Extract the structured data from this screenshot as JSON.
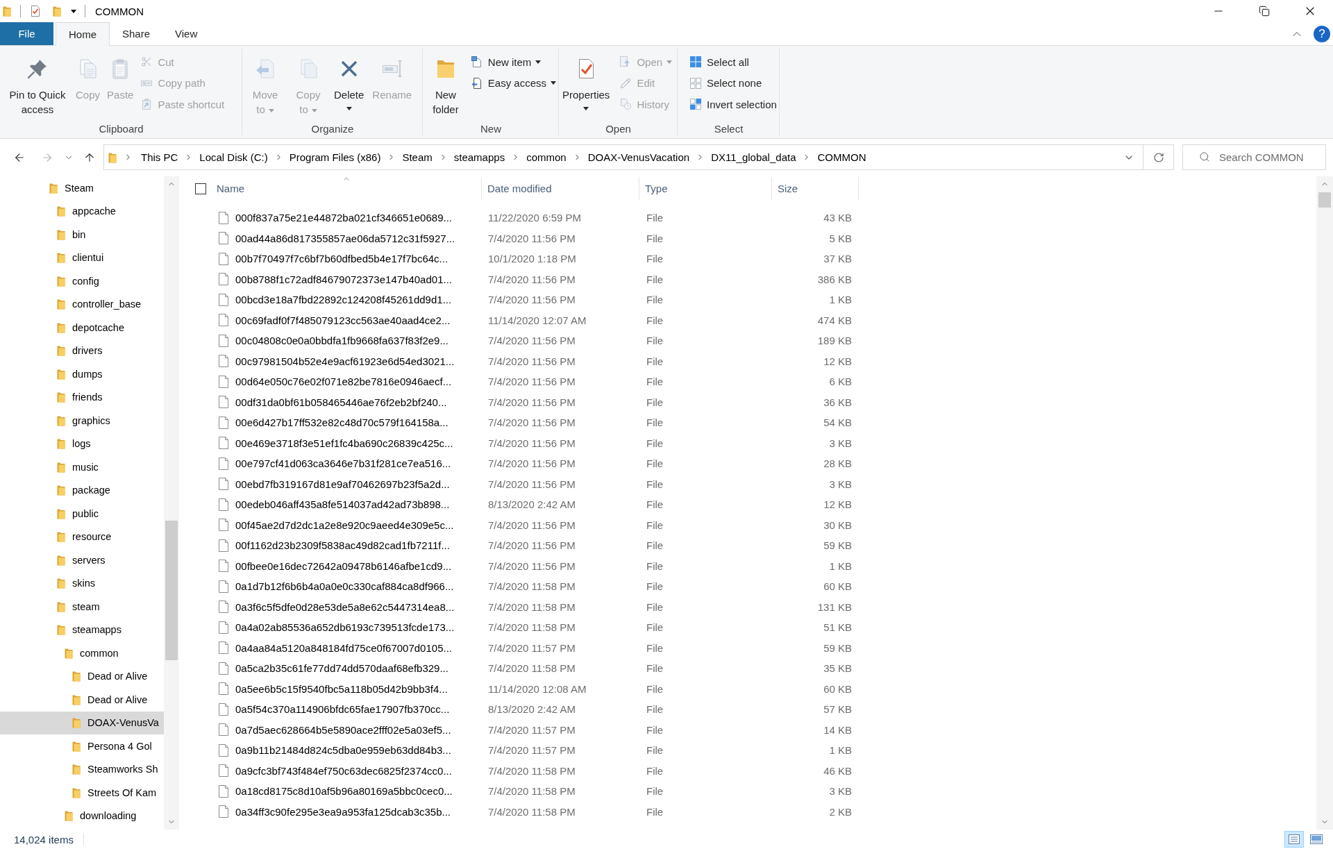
{
  "window": {
    "title": "COMMON"
  },
  "ribbon_tabs": [
    {
      "label": "File",
      "kind": "file",
      "selected": false
    },
    {
      "label": "Home",
      "kind": "tab",
      "selected": true
    },
    {
      "label": "Share",
      "kind": "tab",
      "selected": false
    },
    {
      "label": "View",
      "kind": "tab",
      "selected": false
    }
  ],
  "help_button": "?",
  "ribbon_groups": [
    {
      "label": "Clipboard",
      "commands": [
        {
          "label": "Pin to Quick access",
          "kind": "large",
          "disabled": false,
          "dropdown": false
        },
        {
          "label": "Copy",
          "kind": "large",
          "disabled": true,
          "dropdown": false
        },
        {
          "label": "Paste",
          "kind": "large",
          "disabled": true,
          "dropdown": false
        },
        {
          "label": "Cut",
          "kind": "small",
          "disabled": true,
          "dropdown": false
        },
        {
          "label": "Copy path",
          "kind": "small",
          "disabled": true,
          "dropdown": false
        },
        {
          "label": "Paste shortcut",
          "kind": "small",
          "disabled": true,
          "dropdown": false
        }
      ]
    },
    {
      "label": "Organize",
      "commands": [
        {
          "label": "Move to",
          "kind": "large",
          "disabled": true,
          "dropdown": true
        },
        {
          "label": "Copy to",
          "kind": "large",
          "disabled": true,
          "dropdown": true
        },
        {
          "label": "Delete",
          "kind": "large",
          "disabled": false,
          "dropdown": true
        },
        {
          "label": "Rename",
          "kind": "large",
          "disabled": true,
          "dropdown": false
        }
      ]
    },
    {
      "label": "New",
      "commands": [
        {
          "label": "New folder",
          "kind": "large",
          "disabled": false,
          "dropdown": false
        },
        {
          "label": "New item",
          "kind": "small",
          "disabled": false,
          "dropdown": true
        },
        {
          "label": "Easy access",
          "kind": "small",
          "disabled": false,
          "dropdown": true
        }
      ]
    },
    {
      "label": "Open",
      "commands": [
        {
          "label": "Properties",
          "kind": "large",
          "disabled": false,
          "dropdown": true
        },
        {
          "label": "Open",
          "kind": "small",
          "disabled": true,
          "dropdown": true
        },
        {
          "label": "Edit",
          "kind": "small",
          "disabled": true,
          "dropdown": false
        },
        {
          "label": "History",
          "kind": "small",
          "disabled": true,
          "dropdown": false
        }
      ]
    },
    {
      "label": "Select",
      "commands": [
        {
          "label": "Select all",
          "kind": "small",
          "disabled": false,
          "dropdown": false
        },
        {
          "label": "Select none",
          "kind": "small",
          "disabled": false,
          "dropdown": false
        },
        {
          "label": "Invert selection",
          "kind": "small",
          "disabled": false,
          "dropdown": false
        }
      ]
    }
  ],
  "navigation": {
    "back_disabled": false,
    "forward_disabled": true
  },
  "breadcrumb": [
    "This PC",
    "Local Disk (C:)",
    "Program Files (x86)",
    "Steam",
    "steamapps",
    "common",
    "DOAX-VenusVacation",
    "DX11_global_data",
    "COMMON"
  ],
  "search": {
    "placeholder": "Search COMMON"
  },
  "sidebar": {
    "items": [
      {
        "label": "Steam",
        "selected": false,
        "children": [
          {
            "label": "appcache",
            "selected": false
          },
          {
            "label": "bin",
            "selected": false
          },
          {
            "label": "clientui",
            "selected": false
          },
          {
            "label": "config",
            "selected": false
          },
          {
            "label": "controller_base",
            "selected": false
          },
          {
            "label": "depotcache",
            "selected": false
          },
          {
            "label": "drivers",
            "selected": false
          },
          {
            "label": "dumps",
            "selected": false
          },
          {
            "label": "friends",
            "selected": false
          },
          {
            "label": "graphics",
            "selected": false
          },
          {
            "label": "logs",
            "selected": false
          },
          {
            "label": "music",
            "selected": false
          },
          {
            "label": "package",
            "selected": false
          },
          {
            "label": "public",
            "selected": false
          },
          {
            "label": "resource",
            "selected": false
          },
          {
            "label": "servers",
            "selected": false
          },
          {
            "label": "skins",
            "selected": false
          },
          {
            "label": "steam",
            "selected": false
          },
          {
            "label": "steamapps",
            "selected": false,
            "children": [
              {
                "label": "common",
                "selected": false,
                "children": [
                  {
                    "label": "Dead or Alive",
                    "selected": false
                  },
                  {
                    "label": "Dead or Alive",
                    "selected": false
                  },
                  {
                    "label": "DOAX-VenusVa",
                    "selected": true
                  },
                  {
                    "label": "Persona 4 Gol",
                    "selected": false
                  },
                  {
                    "label": "Steamworks Sh",
                    "selected": false
                  },
                  {
                    "label": "Streets Of Kam",
                    "selected": false
                  }
                ]
              },
              {
                "label": "downloading",
                "selected": false
              }
            ]
          }
        ]
      }
    ]
  },
  "file_list": {
    "select_all_checked": false,
    "columns": [
      {
        "label": "Name",
        "sorted": true
      },
      {
        "label": "Date modified",
        "sorted": false
      },
      {
        "label": "Type",
        "sorted": false
      },
      {
        "label": "Size",
        "sorted": false
      }
    ],
    "rows": [
      {
        "name": "000f837a75e21e44872ba021cf346651e0689...",
        "date_modified": "11/22/2020 6:59 PM",
        "type": "File",
        "size": "43 KB"
      },
      {
        "name": "00ad44a86d817355857ae06da5712c31f5927...",
        "date_modified": "7/4/2020 11:56 PM",
        "type": "File",
        "size": "5 KB"
      },
      {
        "name": "00b7f70497f7c6bf7b60dfbed5b4e17f7bc64c...",
        "date_modified": "10/1/2020 1:18 PM",
        "type": "File",
        "size": "37 KB"
      },
      {
        "name": "00b8788f1c72adf84679072373e147b40ad01...",
        "date_modified": "7/4/2020 11:56 PM",
        "type": "File",
        "size": "386 KB"
      },
      {
        "name": "00bcd3e18a7fbd22892c124208f45261dd9d1...",
        "date_modified": "7/4/2020 11:56 PM",
        "type": "File",
        "size": "1 KB"
      },
      {
        "name": "00c69fadf0f7f485079123cc563ae40aad4ce2...",
        "date_modified": "11/14/2020 12:07 AM",
        "type": "File",
        "size": "474 KB"
      },
      {
        "name": "00c04808c0e0a0bbdfa1fb9668fa637f83f2e9...",
        "date_modified": "7/4/2020 11:56 PM",
        "type": "File",
        "size": "189 KB"
      },
      {
        "name": "00c97981504b52e4e9acf61923e6d54ed3021...",
        "date_modified": "7/4/2020 11:56 PM",
        "type": "File",
        "size": "12 KB"
      },
      {
        "name": "00d64e050c76e02f071e82be7816e0946aecf...",
        "date_modified": "7/4/2020 11:56 PM",
        "type": "File",
        "size": "6 KB"
      },
      {
        "name": "00df31da0bf61b058465446ae76f2eb2bf240...",
        "date_modified": "7/4/2020 11:56 PM",
        "type": "File",
        "size": "36 KB"
      },
      {
        "name": "00e6d427b17ff532e82c48d70c579f164158a...",
        "date_modified": "7/4/2020 11:56 PM",
        "type": "File",
        "size": "54 KB"
      },
      {
        "name": "00e469e3718f3e51ef1fc4ba690c26839c425c...",
        "date_modified": "7/4/2020 11:56 PM",
        "type": "File",
        "size": "3 KB"
      },
      {
        "name": "00e797cf41d063ca3646e7b31f281ce7ea516...",
        "date_modified": "7/4/2020 11:56 PM",
        "type": "File",
        "size": "28 KB"
      },
      {
        "name": "00ebd7fb319167d81e9af70462697b23f5a2d...",
        "date_modified": "7/4/2020 11:56 PM",
        "type": "File",
        "size": "3 KB"
      },
      {
        "name": "00edeb046aff435a8fe514037ad42ad73b898...",
        "date_modified": "8/13/2020 2:42 AM",
        "type": "File",
        "size": "12 KB"
      },
      {
        "name": "00f45ae2d7d2dc1a2e8e920c9aeed4e309e5c...",
        "date_modified": "7/4/2020 11:56 PM",
        "type": "File",
        "size": "30 KB"
      },
      {
        "name": "00f1162d23b2309f5838ac49d82cad1fb7211f...",
        "date_modified": "7/4/2020 11:56 PM",
        "type": "File",
        "size": "59 KB"
      },
      {
        "name": "00fbee0e16dec72642a09478b6146afbe1cd9...",
        "date_modified": "7/4/2020 11:56 PM",
        "type": "File",
        "size": "1 KB"
      },
      {
        "name": "0a1d7b12f6b6b4a0a0e0c330caf884ca8df966...",
        "date_modified": "7/4/2020 11:58 PM",
        "type": "File",
        "size": "60 KB"
      },
      {
        "name": "0a3f6c5f5dfe0d28e53de5a8e62c5447314ea8...",
        "date_modified": "7/4/2020 11:58 PM",
        "type": "File",
        "size": "131 KB"
      },
      {
        "name": "0a4a02ab85536a652db6193c739513fcde173...",
        "date_modified": "7/4/2020 11:58 PM",
        "type": "File",
        "size": "51 KB"
      },
      {
        "name": "0a4aa84a5120a848184fd75ce0f67007d0105...",
        "date_modified": "7/4/2020 11:57 PM",
        "type": "File",
        "size": "59 KB"
      },
      {
        "name": "0a5ca2b35c61fe77dd74dd570daaf68efb329...",
        "date_modified": "7/4/2020 11:58 PM",
        "type": "File",
        "size": "35 KB"
      },
      {
        "name": "0a5ee6b5c15f9540fbc5a118b05d42b9bb3f4...",
        "date_modified": "11/14/2020 12:08 AM",
        "type": "File",
        "size": "60 KB"
      },
      {
        "name": "0a5f54c370a114906bfdc65fae17907fb370cc...",
        "date_modified": "8/13/2020 2:42 AM",
        "type": "File",
        "size": "57 KB"
      },
      {
        "name": "0a7d5aec628664b5e5890ace2fff02e5a03ef5...",
        "date_modified": "7/4/2020 11:57 PM",
        "type": "File",
        "size": "14 KB"
      },
      {
        "name": "0a9b11b21484d824c5dba0e959eb63dd84b3...",
        "date_modified": "7/4/2020 11:57 PM",
        "type": "File",
        "size": "1 KB"
      },
      {
        "name": "0a9cfc3bf743f484ef750c63dec6825f2374cc0...",
        "date_modified": "7/4/2020 11:58 PM",
        "type": "File",
        "size": "46 KB"
      },
      {
        "name": "0a18cd8175c8d10af5b96a80169a5bbc0cec0...",
        "date_modified": "7/4/2020 11:58 PM",
        "type": "File",
        "size": "3 KB"
      },
      {
        "name": "0a34ff3c90fe295e3ea9a953fa125dcab3c35b...",
        "date_modified": "7/4/2020 11:58 PM",
        "type": "File",
        "size": "2 KB"
      }
    ]
  },
  "status_bar": {
    "item_count": "14,024 items",
    "view_buttons": [
      {
        "kind": "details",
        "selected": true
      },
      {
        "kind": "large_icons",
        "selected": false
      }
    ]
  }
}
